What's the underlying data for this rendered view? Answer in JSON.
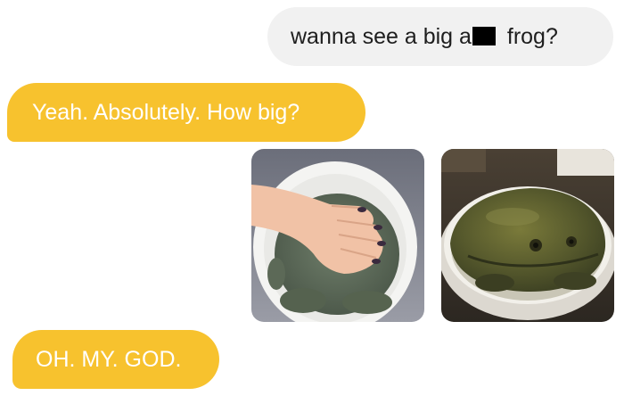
{
  "messages": {
    "sent_1": {
      "before": "wanna see a big a",
      "after": " frog?"
    },
    "received_1": "Yeah. Absolutely. How big?",
    "received_2": "OH. MY. GOD."
  },
  "attachments": [
    {
      "type": "photo",
      "subject": "frog-in-bowl-with-hand"
    },
    {
      "type": "photo",
      "subject": "frog-in-bowl"
    }
  ],
  "colors": {
    "incoming_bubble": "#f7c22e",
    "outgoing_bubble": "#f1f1f1",
    "incoming_text": "#ffffff",
    "outgoing_text": "#1e1e1e"
  }
}
